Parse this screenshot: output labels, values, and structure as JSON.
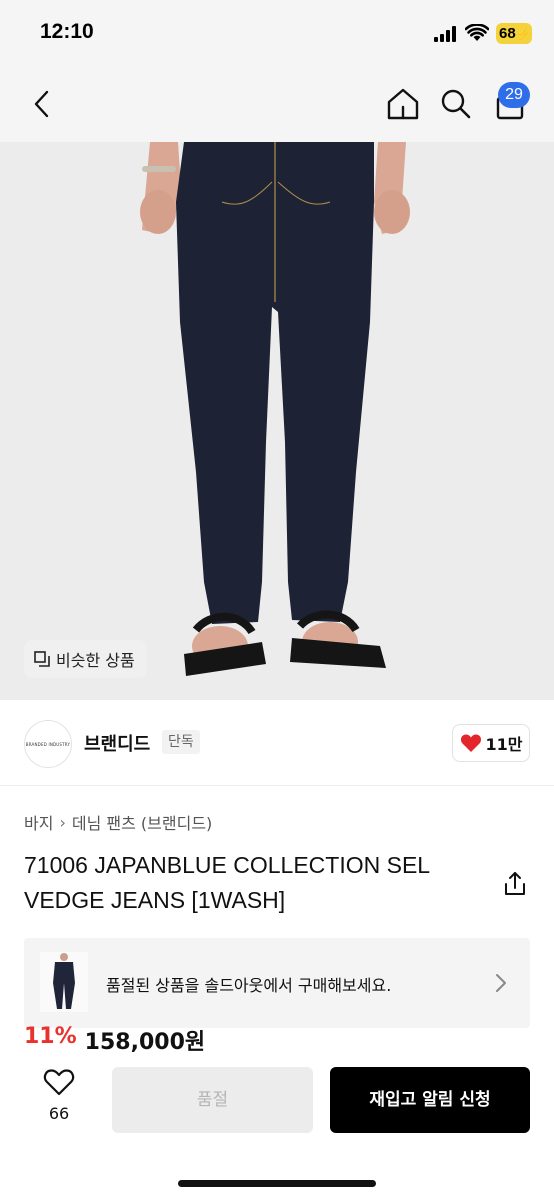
{
  "status_bar": {
    "time": "12:10",
    "battery": "68"
  },
  "nav": {
    "cart_count": "29"
  },
  "image": {
    "similar_label": "비슷한 상품"
  },
  "brand": {
    "logo_text": "BRANDED INDUSTRY",
    "name": "브랜디드",
    "exclusive": "단독",
    "likes": "11만"
  },
  "breadcrumb": {
    "category": "바지",
    "sub": "데님 팬츠 (브랜디드)"
  },
  "product": {
    "title_line1": "71006 JAPANBLUE COLLECTION SEL",
    "title_line2": "VEDGE JEANS [1WASH]",
    "discount": "11%",
    "price": "158,000원"
  },
  "soldout_banner": {
    "text": "품절된 상품을 솔드아웃에서 구매해보세요."
  },
  "bottom": {
    "wish_count": "66",
    "soldout_label": "품절",
    "restock_label": "재입고 알림 신청"
  },
  "colors": {
    "accent_blue": "#2f6ee9",
    "discount_red": "#e8322e",
    "heart_red": "#e3262b"
  }
}
